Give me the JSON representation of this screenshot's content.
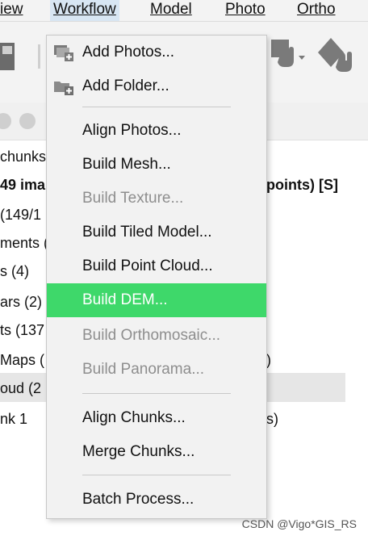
{
  "menubar": {
    "items": [
      {
        "label": "iew"
      },
      {
        "label": "Workflow"
      },
      {
        "label": "Model"
      },
      {
        "label": "Photo"
      },
      {
        "label": "Ortho"
      }
    ]
  },
  "tree": {
    "lines": [
      "chunks",
      "49 ima",
      "points) [S]",
      "(149/1",
      "ments (",
      "s (4)",
      "ars (2)",
      "ts (137",
      "Maps (",
      ")",
      "oud (2",
      "nk 1",
      "s)"
    ]
  },
  "menu": {
    "items": [
      {
        "label": "Add Photos...",
        "state": "enabled",
        "icon": "add-photos-icon"
      },
      {
        "label": "Add Folder...",
        "state": "enabled",
        "icon": "add-folder-icon"
      },
      {
        "label": "Align Photos...",
        "state": "enabled"
      },
      {
        "label": "Build Mesh...",
        "state": "enabled"
      },
      {
        "label": "Build Texture...",
        "state": "disabled"
      },
      {
        "label": "Build Tiled Model...",
        "state": "enabled"
      },
      {
        "label": "Build Point Cloud...",
        "state": "enabled"
      },
      {
        "label": "Build DEM...",
        "state": "highlighted"
      },
      {
        "label": "Build Orthomosaic...",
        "state": "disabled"
      },
      {
        "label": "Build Panorama...",
        "state": "disabled"
      },
      {
        "label": "Align Chunks...",
        "state": "enabled"
      },
      {
        "label": "Merge Chunks...",
        "state": "enabled"
      },
      {
        "label": "Batch Process...",
        "state": "enabled"
      }
    ],
    "highlight_color": "#3ed86a",
    "disabled_color": "#8e8e8e"
  },
  "watermark": "CSDN @Vigo*GIS_RS"
}
